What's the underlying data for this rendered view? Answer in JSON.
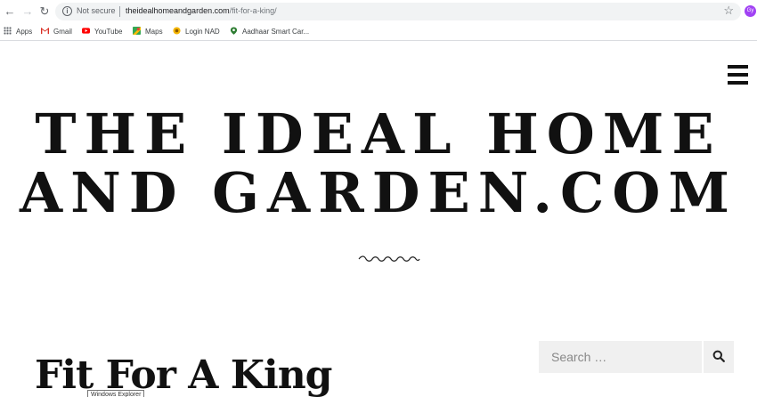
{
  "browser": {
    "security_label": "Not secure",
    "url_host": "theidealhomeandgarden.com",
    "url_path": "/fit-for-a-king/",
    "profile_initials": "Gy",
    "bookmarks": [
      {
        "label": "Apps",
        "icon": "apps-grid-icon"
      },
      {
        "label": "Gmail",
        "icon": "gmail-icon"
      },
      {
        "label": "YouTube",
        "icon": "youtube-icon"
      },
      {
        "label": "Maps",
        "icon": "maps-icon"
      },
      {
        "label": "Login NAD",
        "icon": "login-nad-icon"
      },
      {
        "label": "Aadhaar Smart Car...",
        "icon": "aadhaar-icon"
      }
    ]
  },
  "site": {
    "title_line1": "THE IDEAL HOME",
    "title_line2": "AND GARDEN.COM"
  },
  "search": {
    "placeholder": "Search …"
  },
  "post": {
    "title": "Fit For A King"
  },
  "tooltip": {
    "text": "Windows Explorer"
  },
  "colors": {
    "text": "#111111",
    "search_bg": "#f0f0f0",
    "chrome_omnibox": "#f1f3f4"
  }
}
